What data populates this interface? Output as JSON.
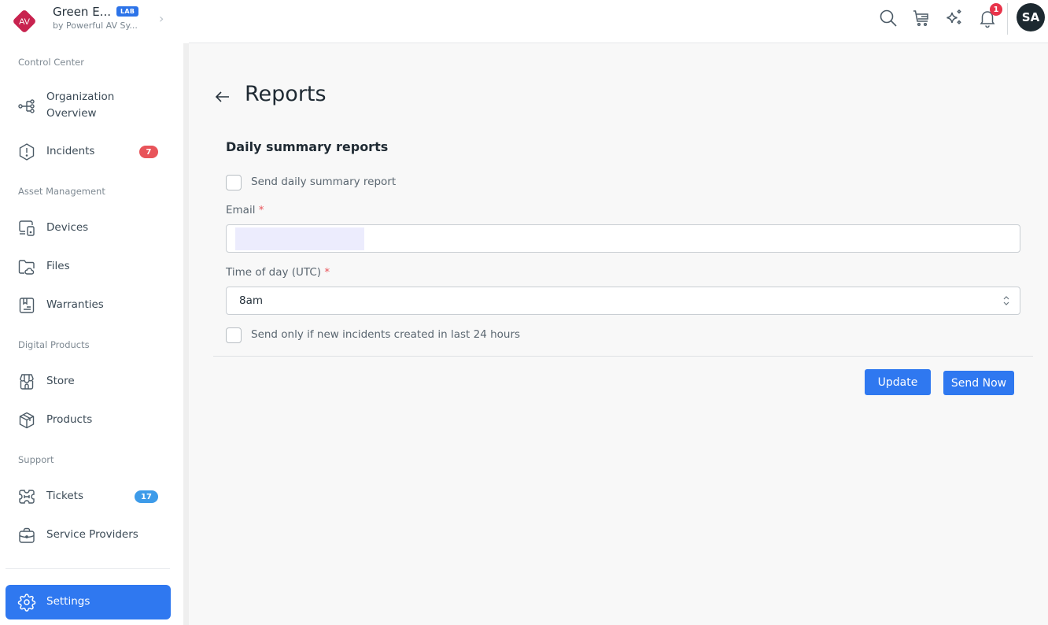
{
  "org": {
    "logo_text": "AV",
    "name": "Green E...",
    "badge": "LAB",
    "subtitle": "by Powerful AV Sy..."
  },
  "sidebar": {
    "sections": [
      {
        "label": "Control Center"
      },
      {
        "label": "Asset Management"
      },
      {
        "label": "Digital Products"
      },
      {
        "label": "Support"
      }
    ],
    "items": [
      {
        "label": "Organization Overview",
        "line1": "Organization",
        "line2": "Overview",
        "icon": "hierarchy-icon"
      },
      {
        "label": "Incidents",
        "icon": "alert-hexagon-icon",
        "badge": "7"
      },
      {
        "label": "Devices",
        "icon": "devices-icon"
      },
      {
        "label": "Files",
        "icon": "folder-cloud-icon"
      },
      {
        "label": "Warranties",
        "icon": "warranty-icon"
      },
      {
        "label": "Store",
        "icon": "store-icon"
      },
      {
        "label": "Products",
        "icon": "box-icon"
      },
      {
        "label": "Tickets",
        "icon": "ticket-icon",
        "badge": "17"
      },
      {
        "label": "Service Providers",
        "icon": "briefcase-icon"
      }
    ],
    "settings": {
      "label": "Settings",
      "icon": "gear-icon"
    }
  },
  "topbar": {
    "icons": [
      "search-icon",
      "cart-icon",
      "sparkles-icon",
      "bell-icon"
    ],
    "notification_count": "1",
    "avatar_initials": "SA"
  },
  "page": {
    "title": "Reports",
    "section_title": "Daily summary reports",
    "send_daily_label": "Send daily summary report",
    "send_daily_checked": false,
    "email_label": "Email",
    "email_value": "",
    "required_mark": "*",
    "time_label": "Time of day (UTC)",
    "time_value": "8am",
    "only_new_label": "Send only if new incidents created in last 24 hours",
    "only_new_checked": false,
    "update_button": "Update",
    "send_now_button": "Send Now"
  },
  "colors": {
    "accent": "#2f78f0",
    "badge_red": "#e8545a",
    "badge_blue": "#3d9be9",
    "logo": "#c8234f"
  }
}
